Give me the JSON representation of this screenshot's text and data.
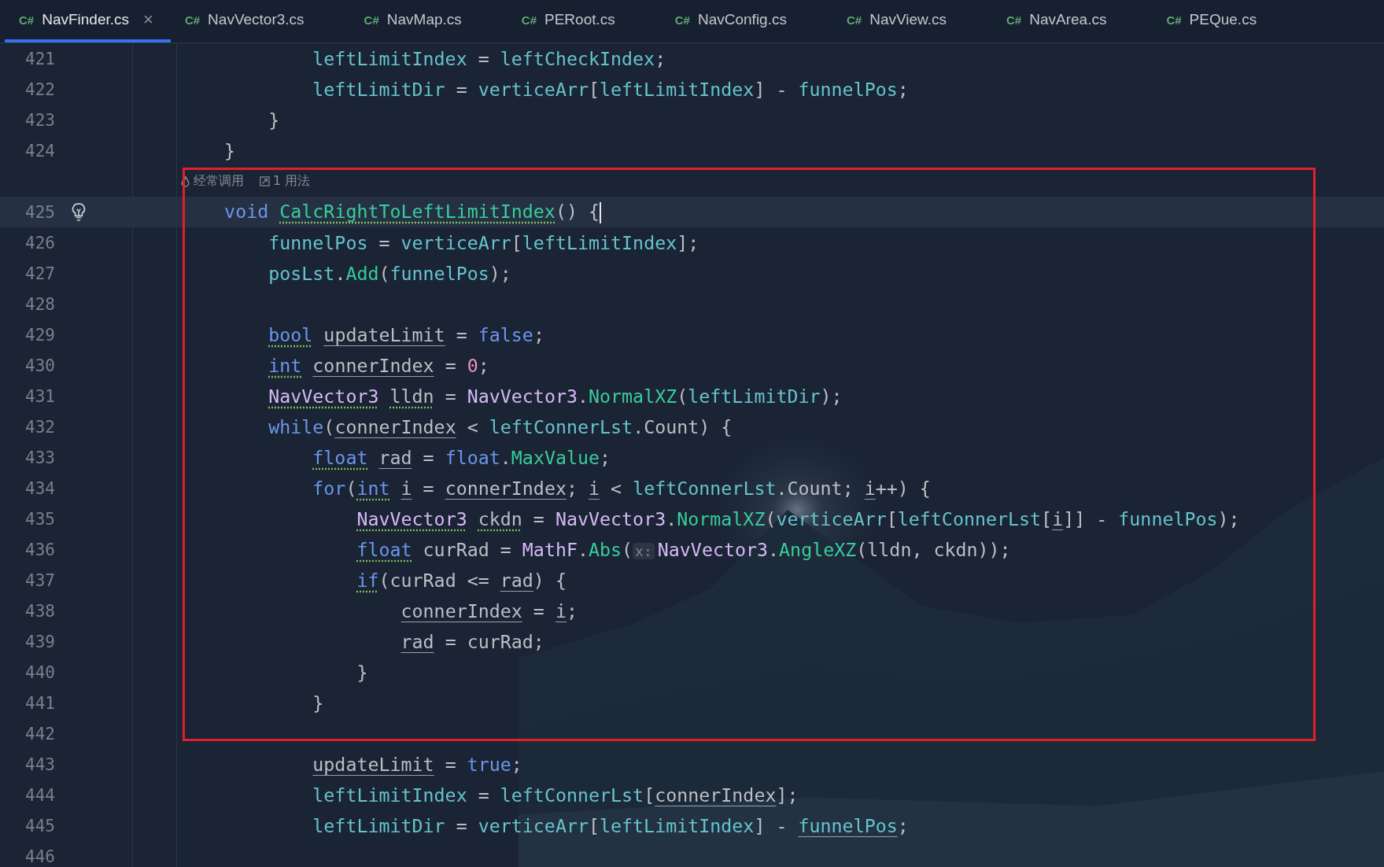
{
  "tabs": [
    {
      "icon": "C#",
      "label": "NavFinder.cs",
      "selected": true,
      "close": "×"
    },
    {
      "icon": "C#",
      "label": "NavVector3.cs",
      "selected": false
    },
    {
      "icon": "C#",
      "label": "NavMap.cs",
      "selected": false
    },
    {
      "icon": "C#",
      "label": "PERoot.cs",
      "selected": false
    },
    {
      "icon": "C#",
      "label": "NavConfig.cs",
      "selected": false
    },
    {
      "icon": "C#",
      "label": "NavView.cs",
      "selected": false
    },
    {
      "icon": "C#",
      "label": "NavArea.cs",
      "selected": false
    },
    {
      "icon": "C#",
      "label": "PEQue.cs",
      "selected": false
    }
  ],
  "editor": {
    "lines": [
      {
        "number": "421",
        "current": false,
        "bulb": false,
        "tokens": [
          {
            "text": "            leftLimitIndex",
            "kind": "field"
          },
          {
            "text": " = ",
            "kind": "plain"
          },
          {
            "text": "leftCheckIndex",
            "kind": "field"
          },
          {
            "text": ";",
            "kind": "plain"
          }
        ]
      },
      {
        "number": "422",
        "current": false,
        "bulb": false,
        "tokens": [
          {
            "text": "            leftLimitDir",
            "kind": "field"
          },
          {
            "text": " = ",
            "kind": "plain"
          },
          {
            "text": "verticeArr",
            "kind": "field"
          },
          {
            "text": "[",
            "kind": "plain"
          },
          {
            "text": "leftLimitIndex",
            "kind": "field"
          },
          {
            "text": "] - ",
            "kind": "plain"
          },
          {
            "text": "funnelPos",
            "kind": "field"
          },
          {
            "text": ";",
            "kind": "plain"
          }
        ]
      },
      {
        "number": "423",
        "current": false,
        "bulb": false,
        "tokens": [
          {
            "text": "        }",
            "kind": "plain"
          }
        ]
      },
      {
        "number": "424",
        "current": false,
        "bulb": false,
        "tokens": [
          {
            "text": "    }",
            "kind": "plain"
          }
        ]
      },
      {
        "number": "425",
        "current": true,
        "bulb": true,
        "code_vision": [
          {
            "kind": "frequency",
            "text": "经常调用"
          },
          {
            "kind": "usages",
            "text": "1 用法"
          }
        ],
        "tokens": [
          {
            "text": "    void",
            "kind": "keyword"
          },
          {
            "text": " CalcRightToLeftLimitIndex",
            "kind": "method",
            "warning": true
          },
          {
            "text": "() {",
            "kind": "plain"
          }
        ]
      },
      {
        "number": "426",
        "current": false,
        "bulb": false,
        "tokens": [
          {
            "text": "        funnelPos",
            "kind": "field"
          },
          {
            "text": " = ",
            "kind": "plain"
          },
          {
            "text": "verticeArr",
            "kind": "field"
          },
          {
            "text": "[",
            "kind": "plain"
          },
          {
            "text": "leftLimitIndex",
            "kind": "field"
          },
          {
            "text": "];",
            "kind": "plain"
          }
        ]
      },
      {
        "number": "427",
        "current": false,
        "bulb": false,
        "tokens": [
          {
            "text": "        posLst",
            "kind": "field"
          },
          {
            "text": ".",
            "kind": "plain"
          },
          {
            "text": "Add",
            "kind": "method"
          },
          {
            "text": "(",
            "kind": "plain"
          },
          {
            "text": "funnelPos",
            "kind": "field"
          },
          {
            "text": ");",
            "kind": "plain"
          }
        ]
      },
      {
        "number": "428",
        "current": false,
        "bulb": false
      },
      {
        "number": "429",
        "current": false,
        "bulb": false,
        "tokens": [
          {
            "text": "        bool",
            "kind": "keyword",
            "warning": true
          },
          {
            "text": " updateLimit",
            "kind": "plain",
            "underlined": true
          },
          {
            "text": " = ",
            "kind": "plain"
          },
          {
            "text": "false",
            "kind": "keyword"
          },
          {
            "text": ";",
            "kind": "plain"
          }
        ]
      },
      {
        "number": "430",
        "current": false,
        "bulb": false,
        "tokens": [
          {
            "text": "        int",
            "kind": "keyword",
            "warning": true
          },
          {
            "text": " connerIndex",
            "kind": "plain",
            "underlined": true
          },
          {
            "text": " = ",
            "kind": "plain"
          },
          {
            "text": "0",
            "kind": "number"
          },
          {
            "text": ";",
            "kind": "plain"
          }
        ]
      },
      {
        "number": "431",
        "current": false,
        "bulb": false,
        "tokens": [
          {
            "text": "        NavVector3",
            "kind": "type",
            "warning": true
          },
          {
            "text": " lldn",
            "kind": "plain",
            "warning": true
          },
          {
            "text": " = ",
            "kind": "plain"
          },
          {
            "text": "NavVector3",
            "kind": "type"
          },
          {
            "text": ".",
            "kind": "plain"
          },
          {
            "text": "NormalXZ",
            "kind": "method"
          },
          {
            "text": "(",
            "kind": "plain"
          },
          {
            "text": "leftLimitDir",
            "kind": "field"
          },
          {
            "text": ");",
            "kind": "plain"
          }
        ]
      },
      {
        "number": "432",
        "current": false,
        "bulb": false,
        "tokens": [
          {
            "text": "        while",
            "kind": "keyword"
          },
          {
            "text": "(",
            "kind": "plain"
          },
          {
            "text": "connerIndex",
            "kind": "plain",
            "underlined": true
          },
          {
            "text": " < ",
            "kind": "plain"
          },
          {
            "text": "leftConnerLst",
            "kind": "field"
          },
          {
            "text": ".Count) {",
            "kind": "plain"
          }
        ]
      },
      {
        "number": "433",
        "current": false,
        "bulb": false,
        "tokens": [
          {
            "text": "            float",
            "kind": "keyword",
            "warning": true
          },
          {
            "text": " rad",
            "kind": "plain",
            "underlined": true
          },
          {
            "text": " = ",
            "kind": "plain"
          },
          {
            "text": "float",
            "kind": "keyword"
          },
          {
            "text": ".",
            "kind": "plain"
          },
          {
            "text": "MaxValue",
            "kind": "method"
          },
          {
            "text": ";",
            "kind": "plain"
          }
        ]
      },
      {
        "number": "434",
        "current": false,
        "bulb": false,
        "tokens": [
          {
            "text": "            for",
            "kind": "keyword"
          },
          {
            "text": "(",
            "kind": "plain"
          },
          {
            "text": "int",
            "kind": "keyword",
            "warning": true
          },
          {
            "text": " i",
            "kind": "plain",
            "underlined": true
          },
          {
            "text": " = ",
            "kind": "plain"
          },
          {
            "text": "connerIndex",
            "kind": "plain",
            "underlined": true
          },
          {
            "text": "; ",
            "kind": "plain"
          },
          {
            "text": "i",
            "kind": "plain",
            "underlined": true
          },
          {
            "text": " < ",
            "kind": "plain"
          },
          {
            "text": "leftConnerLst",
            "kind": "field"
          },
          {
            "text": ".Count; ",
            "kind": "plain"
          },
          {
            "text": "i",
            "kind": "plain",
            "underlined": true
          },
          {
            "text": "++) {",
            "kind": "plain"
          }
        ]
      },
      {
        "number": "435",
        "current": false,
        "bulb": false,
        "tokens": [
          {
            "text": "                NavVector3",
            "kind": "type",
            "warning": true
          },
          {
            "text": " ckdn",
            "kind": "plain",
            "warning": true
          },
          {
            "text": " = ",
            "kind": "plain"
          },
          {
            "text": "NavVector3",
            "kind": "type"
          },
          {
            "text": ".",
            "kind": "plain"
          },
          {
            "text": "NormalXZ",
            "kind": "method"
          },
          {
            "text": "(",
            "kind": "plain"
          },
          {
            "text": "verticeArr",
            "kind": "field"
          },
          {
            "text": "[",
            "kind": "plain"
          },
          {
            "text": "leftConnerLst",
            "kind": "field"
          },
          {
            "text": "[",
            "kind": "plain"
          },
          {
            "text": "i",
            "kind": "plain",
            "underlined": true
          },
          {
            "text": "]] - ",
            "kind": "plain"
          },
          {
            "text": "funnelPos",
            "kind": "field"
          },
          {
            "text": ");",
            "kind": "plain"
          }
        ]
      },
      {
        "number": "436",
        "current": false,
        "bulb": false,
        "tokens": [
          {
            "text": "                float",
            "kind": "keyword",
            "warning": true
          },
          {
            "text": " curRad = ",
            "kind": "plain"
          },
          {
            "text": "MathF",
            "kind": "type"
          },
          {
            "text": ".",
            "kind": "plain"
          },
          {
            "text": "Abs",
            "kind": "method"
          },
          {
            "text": "(",
            "kind": "plain"
          },
          {
            "text": "x:",
            "kind": "hint"
          },
          {
            "text": "NavVector3",
            "kind": "type"
          },
          {
            "text": ".",
            "kind": "plain"
          },
          {
            "text": "AngleXZ",
            "kind": "method"
          },
          {
            "text": "(lldn, ckdn));",
            "kind": "plain"
          }
        ]
      },
      {
        "number": "437",
        "current": false,
        "bulb": false,
        "tokens": [
          {
            "text": "                if",
            "kind": "keyword",
            "warning": true
          },
          {
            "text": "(curRad <= ",
            "kind": "plain"
          },
          {
            "text": "rad",
            "kind": "plain",
            "underlined": true
          },
          {
            "text": ") {",
            "kind": "plain"
          }
        ]
      },
      {
        "number": "438",
        "current": false,
        "bulb": false,
        "tokens": [
          {
            "text": "                    connerIndex",
            "kind": "plain",
            "underlined": true
          },
          {
            "text": " = ",
            "kind": "plain"
          },
          {
            "text": "i",
            "kind": "plain",
            "underlined": true
          },
          {
            "text": ";",
            "kind": "plain"
          }
        ]
      },
      {
        "number": "439",
        "current": false,
        "bulb": false,
        "tokens": [
          {
            "text": "                    rad",
            "kind": "plain",
            "underlined": true
          },
          {
            "text": " = curRad;",
            "kind": "plain"
          }
        ]
      },
      {
        "number": "440",
        "current": false,
        "bulb": false,
        "tokens": [
          {
            "text": "                }",
            "kind": "plain"
          }
        ]
      },
      {
        "number": "441",
        "current": false,
        "bulb": false,
        "tokens": [
          {
            "text": "            }",
            "kind": "plain"
          }
        ]
      },
      {
        "number": "442",
        "current": false,
        "bulb": false
      },
      {
        "number": "443",
        "current": false,
        "bulb": false,
        "tokens": [
          {
            "text": "            updateLimit",
            "kind": "plain",
            "underlined": true
          },
          {
            "text": " = ",
            "kind": "plain"
          },
          {
            "text": "true",
            "kind": "keyword"
          },
          {
            "text": ";",
            "kind": "plain"
          }
        ]
      },
      {
        "number": "444",
        "current": false,
        "bulb": false,
        "tokens": [
          {
            "text": "            leftLimitIndex",
            "kind": "field"
          },
          {
            "text": " = ",
            "kind": "plain"
          },
          {
            "text": "leftConnerLst",
            "kind": "field"
          },
          {
            "text": "[",
            "kind": "plain"
          },
          {
            "text": "connerIndex",
            "kind": "plain",
            "underlined": true
          },
          {
            "text": "];",
            "kind": "plain"
          }
        ]
      },
      {
        "number": "445",
        "current": false,
        "bulb": false,
        "tokens": [
          {
            "text": "            leftLimitDir",
            "kind": "field"
          },
          {
            "text": " = ",
            "kind": "plain"
          },
          {
            "text": "verticeArr",
            "kind": "field"
          },
          {
            "text": "[",
            "kind": "plain"
          },
          {
            "text": "leftLimitIndex",
            "kind": "field"
          },
          {
            "text": "] - ",
            "kind": "plain"
          },
          {
            "text": "funnelPos",
            "kind": "field",
            "underlined": true
          },
          {
            "text": ";",
            "kind": "plain"
          }
        ]
      },
      {
        "number": "446",
        "current": false,
        "bulb": false
      }
    ]
  }
}
